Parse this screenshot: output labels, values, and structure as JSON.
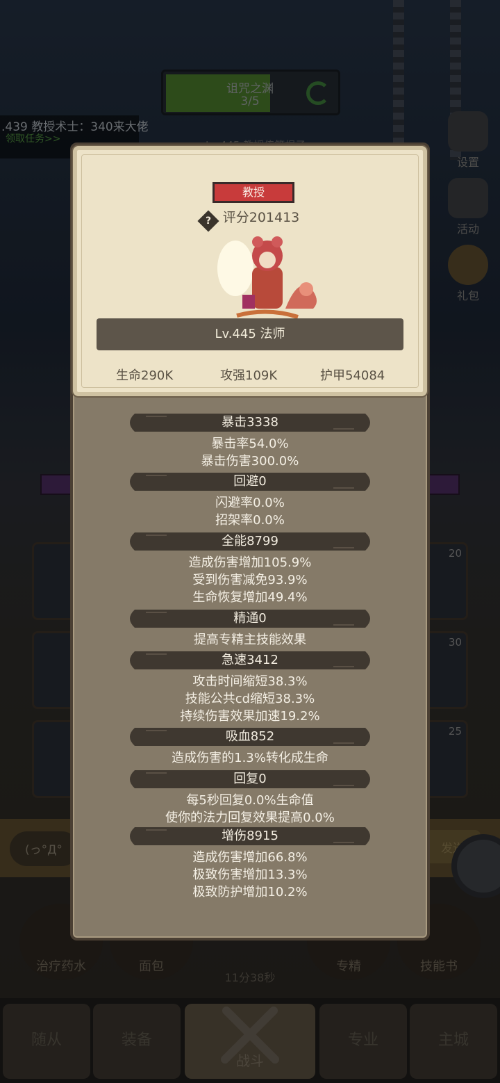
{
  "background": {
    "dungeon": {
      "name": "诅咒之渊",
      "progress": "3/5",
      "progress_fraction": 0.6
    },
    "quest": {
      "text": ".439 教授术士：340来大佬",
      "link": "领取任务>>"
    },
    "behind_name": "Lv.445 教授传第棍子",
    "side_buttons": [
      {
        "label": "设置",
        "icon": "gear-icon"
      },
      {
        "label": "活动",
        "icon": "calendar-icon"
      },
      {
        "label": "礼包",
        "icon": "gift-icon"
      }
    ],
    "slot_counts": [
      "20",
      "30",
      "25"
    ],
    "chat_placeholder": "(っ°Д°",
    "send_label": "发送",
    "items": [
      {
        "label": "治疗药水",
        "icon": "potion-icon"
      },
      {
        "label": "面包",
        "icon": "bread-icon"
      },
      {
        "label": "专精",
        "icon": "specialization-icon"
      },
      {
        "label": "技能书",
        "icon": "skillbook-icon"
      }
    ],
    "timer": "11分38秒",
    "nav": [
      {
        "label": "随从"
      },
      {
        "label": "装备"
      },
      {
        "label": "战斗"
      },
      {
        "label": "专业"
      },
      {
        "label": "主城"
      }
    ]
  },
  "card": {
    "title": "教授",
    "score": "评分201413",
    "level_class": "Lv.445 法师",
    "hp": "生命290K",
    "attack": "攻强109K",
    "armor": "护甲54084"
  },
  "attributes": [
    {
      "header": "暴击3338",
      "lines": [
        "暴击率54.0%",
        "暴击伤害300.0%"
      ]
    },
    {
      "header": "回避0",
      "lines": [
        "闪避率0.0%",
        "招架率0.0%"
      ]
    },
    {
      "header": "全能8799",
      "lines": [
        "造成伤害增加105.9%",
        "受到伤害减免93.9%",
        "生命恢复增加49.4%"
      ]
    },
    {
      "header": "精通0",
      "lines": [
        "提高专精主技能效果"
      ]
    },
    {
      "header": "急速3412",
      "lines": [
        "攻击时间缩短38.3%",
        "技能公共cd缩短38.3%",
        "持续伤害效果加速19.2%"
      ]
    },
    {
      "header": "吸血852",
      "lines": [
        "造成伤害的1.3%转化成生命"
      ]
    },
    {
      "header": "回复0",
      "lines": [
        "每5秒回复0.0%生命值",
        "使你的法力回复效果提高0.0%"
      ]
    },
    {
      "header": "增伤8915",
      "lines": [
        "造成伤害增加66.8%",
        "极致伤害增加13.3%",
        "极致防护增加10.2%"
      ]
    }
  ],
  "colors": {
    "panel": "#857a68",
    "card": "#ede3c8",
    "badge": "#c83b3b",
    "header_band": "#3f3830"
  }
}
